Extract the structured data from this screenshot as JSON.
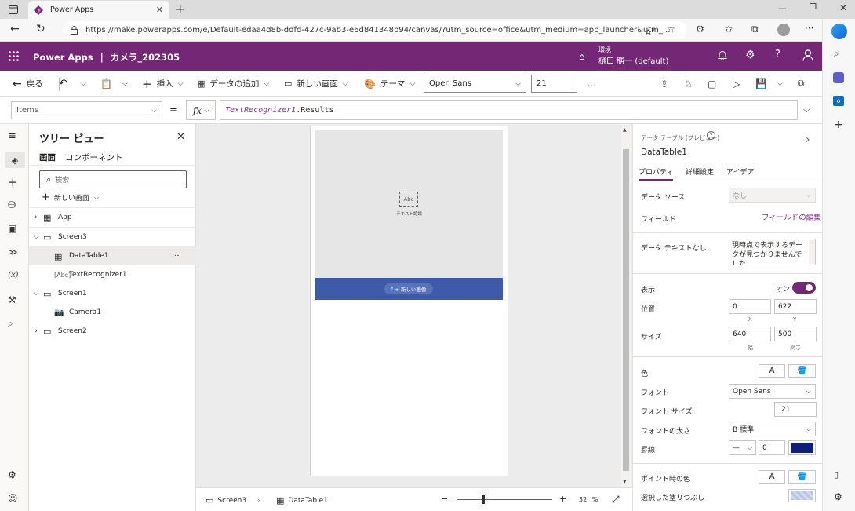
{
  "browser": {
    "tab_title": "Power Apps",
    "url": "https://make.powerapps.com/e/Default-edaa4d8b-ddfd-427c-9ab3-e6d841348b94/canvas/?utm_source=office&utm_medium=app_launcher&utm_..."
  },
  "header": {
    "app_name": "Power Apps",
    "separator": "|",
    "doc_title": "カメラ_202305",
    "env_label": "環境",
    "env_name": "樋口 勝一 (default)"
  },
  "cmdbar": {
    "back": "戻る",
    "insert": "挿入",
    "add_data": "データの追加",
    "new_screen": "新しい画面",
    "theme": "テーマ",
    "font": "Open Sans",
    "font_size": "21",
    "more": "…"
  },
  "formula": {
    "property": "Items",
    "equals": "=",
    "fx": "fx",
    "expr_ident": "TextRecognizer1",
    "expr_rest": ".Results"
  },
  "tree": {
    "title": "ツリー ビュー",
    "tab_screens": "画面",
    "tab_components": "コンポーネント",
    "search_placeholder": "検索",
    "new_screen": "新しい画面",
    "items": [
      {
        "label": "App"
      },
      {
        "label": "Screen3"
      },
      {
        "label": "DataTable1"
      },
      {
        "label": "TextRecognizer1"
      },
      {
        "label": "Screen1"
      },
      {
        "label": "Camera1"
      },
      {
        "label": "Screen2"
      }
    ],
    "more": "···"
  },
  "canvas": {
    "recognizer_glyph": "Abc",
    "recognizer_label": "テキスト認識",
    "new_image_button": "+ 新しい画像",
    "accent_color": "#3d5ba9"
  },
  "bottombar": {
    "crumb_screen": "Screen3",
    "crumb_control": "DataTable1",
    "zoom_minus": "−",
    "zoom_plus": "+",
    "zoom_value": "52",
    "zoom_unit": "%"
  },
  "props": {
    "type_label": "データ テーブル (プレビュー)",
    "control_name": "DataTable1",
    "tabs": [
      "プロパティ",
      "詳細設定",
      "アイデア"
    ],
    "data_source_label": "データ ソース",
    "data_source_value": "なし",
    "fields_label": "フィールド",
    "fields_link": "フィールドの編集",
    "no_data_label": "データ テキストなし",
    "no_data_value": "現時点で表示するデータが見つかりませんでした。",
    "visible_label": "表示",
    "visible_value": "オン",
    "position_label": "位置",
    "pos_x": "0",
    "pos_y": "622",
    "x_label": "X",
    "y_label": "Y",
    "size_label": "サイズ",
    "width": "640",
    "height": "500",
    "w_label": "幅",
    "h_label": "高さ",
    "color_label": "色",
    "font_label": "フォント",
    "font_value": "Open Sans",
    "font_size_label": "フォント サイズ",
    "font_size_value": "21",
    "font_weight_label": "フォントの太さ",
    "font_weight_value": "B  標準",
    "border_label": "罫線",
    "border_width": "0",
    "border_color": "#0f1f78",
    "hover_color_label": "ポイント時の色",
    "selected_fill_label": "選択した塗りつぶし",
    "text_glyph": "A",
    "toggle_color": "#742774"
  }
}
